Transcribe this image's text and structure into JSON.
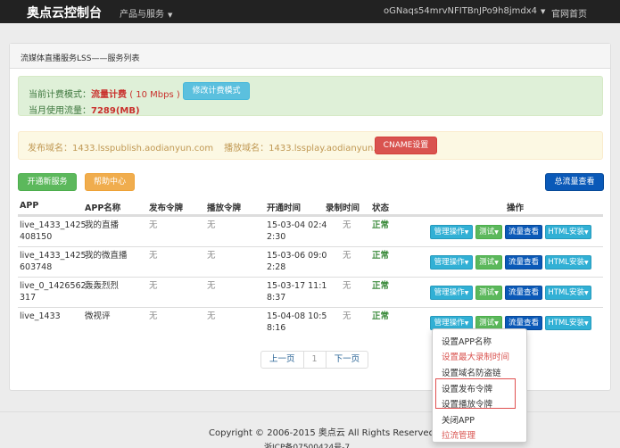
{
  "navbar": {
    "brand": "奥点云控制台",
    "products": "产品与服务",
    "user": "oGNaqs54mrvNFITBnJPo9h8jmdx4",
    "home": "官网首页"
  },
  "panel": {
    "title": "流媒体直播服务LSS——服务列表"
  },
  "billing": {
    "label": "当前计费模式：",
    "mode": "流量计费",
    "rate": "( 10 Mbps )",
    "button": "修改计费模式",
    "usage_label": "当月使用流量：",
    "usage_value": "7289(MB)"
  },
  "domains": {
    "publish": "发布域名：1433.lsspublish.aodianyun.com",
    "play": "播放域名：1433.lssplay.aodianyun.com",
    "cname_button": "CNAME设置"
  },
  "actions": {
    "open_service": "开通新服务",
    "help_center": "帮助中心",
    "total_flow": "总流量查看"
  },
  "table": {
    "headers": [
      "APP",
      "APP名称",
      "发布令牌",
      "播放令牌",
      "开通时间",
      "录制时间",
      "状态",
      "操作"
    ],
    "rows": [
      {
        "app1": "live_1433_1425",
        "app2": "408150",
        "name": "我的直播",
        "pub": "无",
        "play": "无",
        "t1": "15-03-04 02:4",
        "t2": "2:30",
        "rec": "无",
        "status": "正常"
      },
      {
        "app1": "live_1433_1425",
        "app2": "603748",
        "name": "我的微直播",
        "pub": "无",
        "play": "无",
        "t1": "15-03-06 09:0",
        "t2": "2:28",
        "rec": "无",
        "status": "正常"
      },
      {
        "app1": "live_0_1426562",
        "app2": "317",
        "name": "轰轰烈烈",
        "pub": "无",
        "play": "无",
        "t1": "15-03-17 11:1",
        "t2": "8:37",
        "rec": "无",
        "status": "正常"
      },
      {
        "app1": "live_1433",
        "app2": "",
        "name": "微视评",
        "pub": "无",
        "play": "无",
        "t1": "15-04-08 10:5",
        "t2": "8:16",
        "rec": "无",
        "status": "正常"
      }
    ],
    "op_buttons": {
      "manage": "管理操作",
      "test": "测试",
      "flow": "流量查看",
      "html": "HTML安装"
    }
  },
  "pagination": {
    "prev": "上一页",
    "current": "1",
    "next": "下一页"
  },
  "dropdown": {
    "items": [
      "设置APP名称",
      "设置最大录制时间",
      "设置域名防盗链",
      "设置发布令牌",
      "设置播放令牌",
      "关闭APP",
      "拉流管理"
    ]
  },
  "footer": {
    "copyright": "Copyright © 2006-2015 奥点云 All Rights Reserved",
    "icp": "浙ICP备07500424号-7"
  },
  "colors": {
    "navbar": "#222222",
    "alert_green": "#dff0d8",
    "alert_yellow": "#fcf8e3",
    "danger": "#d9534f",
    "primary": "#0a59b8"
  }
}
